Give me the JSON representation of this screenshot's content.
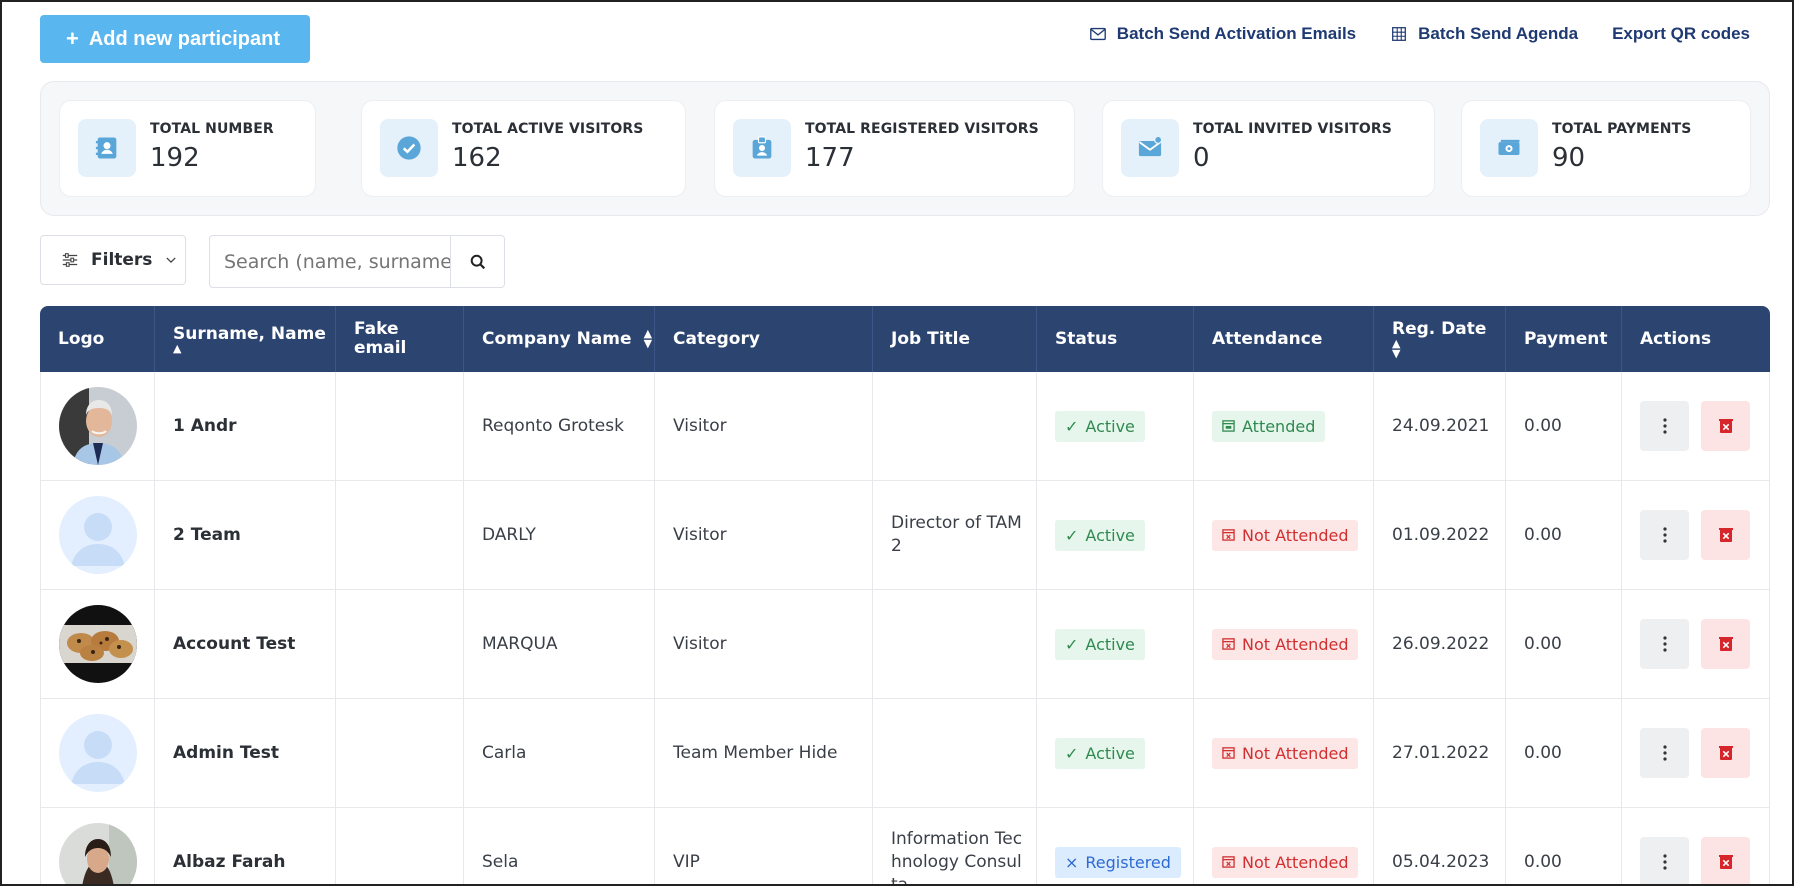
{
  "toolbar": {
    "add_label": "Add new participant",
    "batch_activation_label": "Batch Send Activation Emails",
    "batch_agenda_label": "Batch Send Agenda",
    "export_qr_label": "Export QR codes"
  },
  "stats": [
    {
      "label": "TOTAL NUMBER",
      "value": "192",
      "icon": "contact-card-icon"
    },
    {
      "label": "TOTAL ACTIVE VISITORS",
      "value": "162",
      "icon": "check-circle-icon"
    },
    {
      "label": "TOTAL REGISTERED VISITORS",
      "value": "177",
      "icon": "badge-icon"
    },
    {
      "label": "TOTAL INVITED VISITORS",
      "value": "0",
      "icon": "mail-icon"
    },
    {
      "label": "TOTAL PAYMENTS",
      "value": "90",
      "icon": "money-icon"
    }
  ],
  "filters": {
    "label": "Filters"
  },
  "search": {
    "placeholder": "Search (name, surname, e"
  },
  "table": {
    "headers": {
      "logo": "Logo",
      "name": "Surname, Name",
      "fake_email_1": "Fake",
      "fake_email_2": "email",
      "company": "Company Name",
      "category": "Category",
      "job": "Job Title",
      "status": "Status",
      "attendance": "Attendance",
      "reg_date": "Reg. Date",
      "payment": "Payment",
      "actions": "Actions"
    },
    "rows": [
      {
        "name": "1 Andr",
        "fake_email": "",
        "company": "Reqonto Grotesk",
        "category": "Visitor",
        "job": "",
        "status": "Active",
        "attendance": "Attended",
        "reg_date": "24.09.2021",
        "payment": "0.00",
        "avatar": "photo-man"
      },
      {
        "name": "2 Team",
        "fake_email": "",
        "company": "DARLY",
        "category": "Visitor",
        "job": "Director of TAM 2",
        "status": "Active",
        "attendance": "Not Attended",
        "reg_date": "01.09.2022",
        "payment": "0.00",
        "avatar": "placeholder"
      },
      {
        "name": "Account Test",
        "fake_email": "",
        "company": "MARQUA",
        "category": "Visitor",
        "job": "",
        "status": "Active",
        "attendance": "Not Attended",
        "reg_date": "26.09.2022",
        "payment": "0.00",
        "avatar": "photo-cookies"
      },
      {
        "name": "Admin Test",
        "fake_email": "",
        "company": "Carla",
        "category": "Team Member Hide",
        "job": "",
        "status": "Active",
        "attendance": "Not Attended",
        "reg_date": "27.01.2022",
        "payment": "0.00",
        "avatar": "placeholder"
      },
      {
        "name": "Albaz Farah",
        "fake_email": "",
        "company": "Sela",
        "category": "VIP",
        "job": "Information Technology Consulta",
        "status": "Registered",
        "attendance": "Not Attended",
        "reg_date": "05.04.2023",
        "payment": "0.00",
        "avatar": "photo-woman"
      }
    ]
  },
  "colors": {
    "accent": "#5ab6ee",
    "header_bg": "#2c4470",
    "link": "#1f3a73",
    "active_green": "#2f8a4f",
    "not_attended_red": "#d12f2f",
    "registered_blue": "#2d6ad1"
  }
}
